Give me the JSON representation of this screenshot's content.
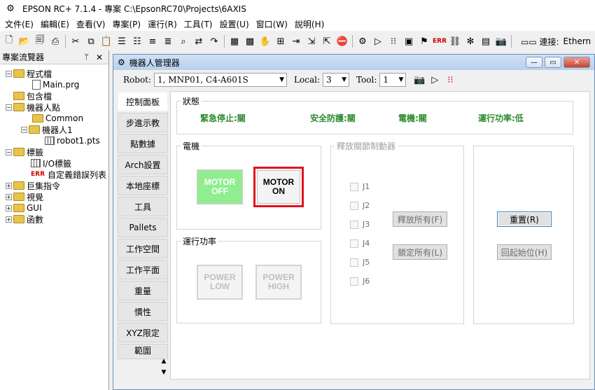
{
  "app": {
    "title": "EPSON RC+ 7.1.4 - 專案 C:\\EpsonRC70\\Projects\\6AXIS"
  },
  "menu": [
    "文件(E)",
    "編輯(E)",
    "查看(V)",
    "專案(P)",
    "運行(R)",
    "工具(T)",
    "設置(U)",
    "窗口(W)",
    "說明(H)"
  ],
  "toolbar": {
    "connection_label": "▭▭ 連接:",
    "connection_value": "Ethern",
    "err_label": "ERR"
  },
  "project_explorer": {
    "title": "專案流覽器",
    "pin": "ᛘ",
    "close": "✕",
    "tree": [
      {
        "label": "程式檔",
        "exp": "−"
      },
      {
        "label": "Main.prg"
      },
      {
        "label": "包含檔"
      },
      {
        "label": "機器人點",
        "exp": "−"
      },
      {
        "label": "Common"
      },
      {
        "label": "機器人1",
        "exp": "−"
      },
      {
        "label": "robot1.pts"
      },
      {
        "label": "標籤",
        "exp": "−"
      },
      {
        "label": "I/O標籤"
      },
      {
        "label": "自定義錯誤列表",
        "prefix": "ERR"
      },
      {
        "label": "巨集指令",
        "exp": "+"
      },
      {
        "label": "視覺",
        "exp": "+"
      },
      {
        "label": "GUI",
        "exp": "+"
      },
      {
        "label": "函數",
        "exp": "+"
      }
    ]
  },
  "robot_manager": {
    "title": "機器人管理器",
    "win_buttons": {
      "minimize": "—",
      "restore": "▭",
      "close": "✕"
    },
    "robot_label": "Robot:",
    "robot_value": "1, MNP01, C4-A601S",
    "local_label": "Local:",
    "local_value": "3",
    "tool_label": "Tool:",
    "tool_value": "1",
    "tabs": [
      "控制面板",
      "步進示教",
      "點數據",
      "Arch設置",
      "本地座標",
      "工具",
      "Pallets",
      "工作空間",
      "工作平面",
      "重量",
      "慣性",
      "XYZ限定",
      "範圍"
    ],
    "active_tab": 0
  },
  "control_panel": {
    "status_group": "狀態",
    "status": {
      "estop": "緊急停止:關",
      "safeguard": "安全防護:關",
      "motor": "電機:關",
      "power": "運行功率:低"
    },
    "motor_group": "電機",
    "motor_off": {
      "line1": "MOTOR",
      "line2": "OFF"
    },
    "motor_on": {
      "line1": "MOTOR",
      "line2": "ON"
    },
    "power_group": "運行功率",
    "power_low": {
      "line1": "POWER",
      "line2": "LOW"
    },
    "power_high": {
      "line1": "POWER",
      "line2": "HIGH"
    },
    "brake_group": "釋放關節制動器",
    "joints": [
      "J1",
      "J2",
      "J3",
      "J4",
      "J5",
      "J6"
    ],
    "release_all": "釋放所有(F)",
    "lock_all": "鎖定所有(L)",
    "reset": "重置(R)",
    "home": "回起始位(H)"
  },
  "colors": {
    "motor_off_bg": "#90ee90",
    "highlight_border": "#e0141c",
    "status_text": "#2e8b2e",
    "title_gradient": "#b9d1ee"
  }
}
